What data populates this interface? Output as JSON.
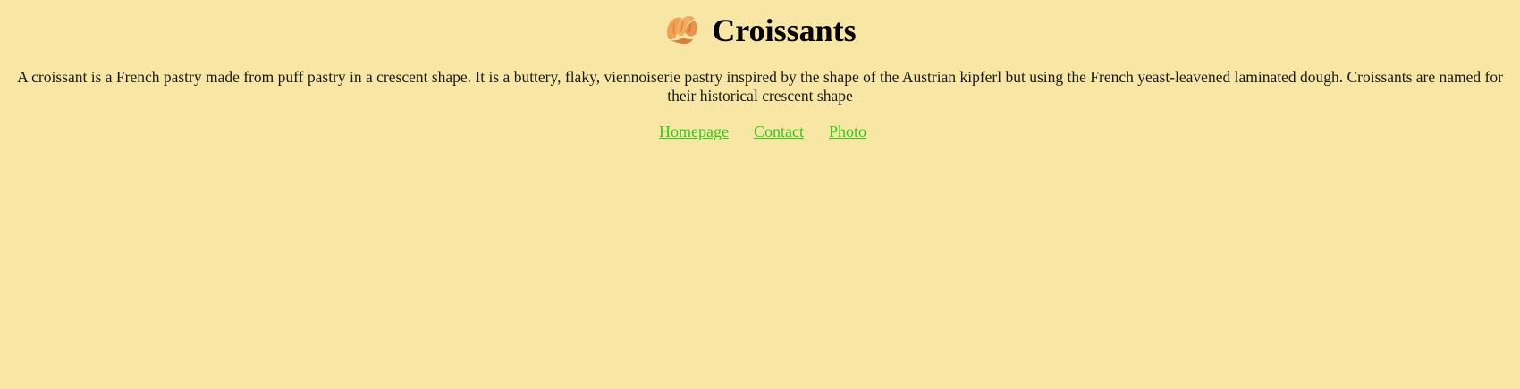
{
  "header": {
    "title": "Croissants",
    "icon": "croissant-icon"
  },
  "main": {
    "description": "A croissant is a French pastry made from puff pastry in a crescent shape. It is a buttery, flaky, viennoiserie pastry inspired by the shape of the Austrian kipferl but using the French yeast-leavened laminated dough. Croissants are named for their historical crescent shape"
  },
  "nav": {
    "links": [
      {
        "label": "Homepage"
      },
      {
        "label": "Contact"
      },
      {
        "label": "Photo"
      }
    ]
  },
  "colors": {
    "background": "#f8e7a4",
    "link": "#2ecc18",
    "croissant_light": "#f3a95a",
    "croissant_dark": "#d9803a"
  }
}
